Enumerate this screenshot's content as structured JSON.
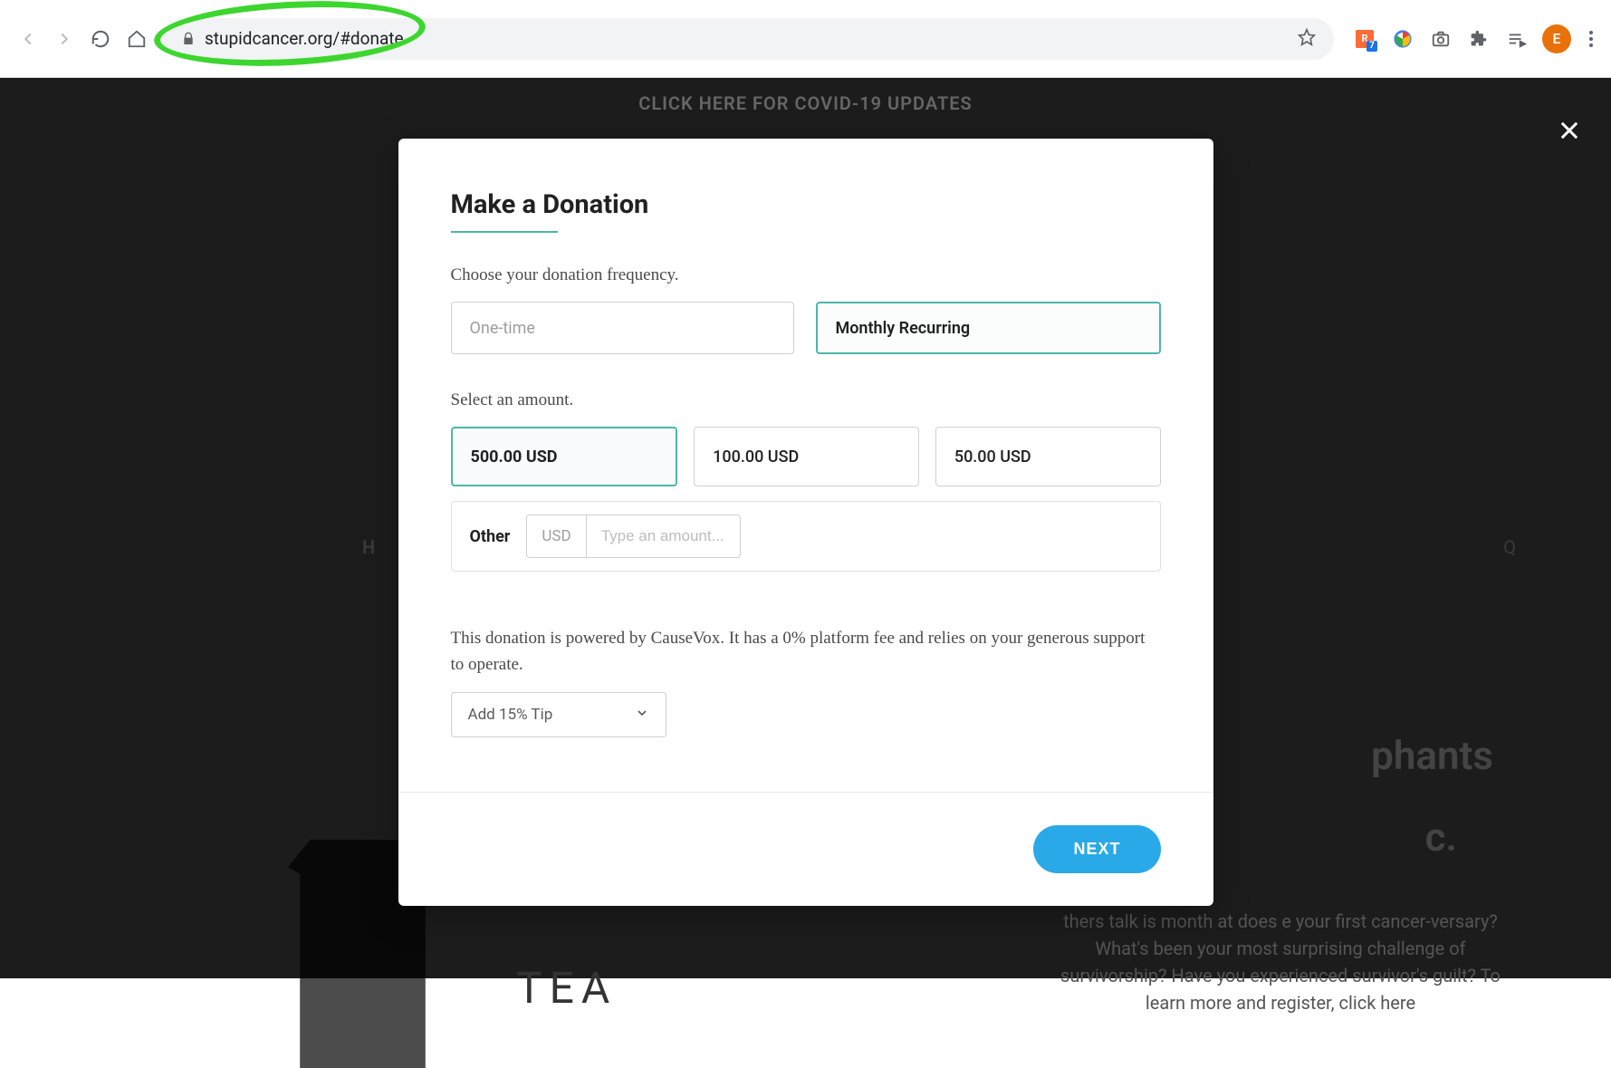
{
  "browser": {
    "url": "stupidcancer.org/#donate",
    "avatar_letter": "E"
  },
  "banner": {
    "covid_text": "CLICK HERE FOR COVID-19 UPDATES"
  },
  "background": {
    "side_H": "H",
    "side_Q": "Q",
    "tea_word": "TEA",
    "headline_part1": "phants",
    "headline_part2": "c.",
    "para": "thers talk is month at does e your first cancer-versary? What's been your most surprising challenge of survivorship? Have you experienced survivor's guilt? To learn more and register, click here"
  },
  "modal": {
    "title": "Make a Donation",
    "freq_label": "Choose your donation frequency.",
    "freq_options": {
      "one_time": "One-time",
      "monthly": "Monthly Recurring"
    },
    "amount_label": "Select an amount.",
    "amounts": {
      "a1": "500.00 USD",
      "a2": "100.00 USD",
      "a3": "50.00 USD"
    },
    "other_label": "Other",
    "currency": "USD",
    "other_placeholder": "Type an amount...",
    "powered_text": "This donation is powered by CauseVox. It has a 0% platform fee and relies on your generous support to operate.",
    "tip_label": "Add 15% Tip",
    "next_button": "NEXT"
  }
}
